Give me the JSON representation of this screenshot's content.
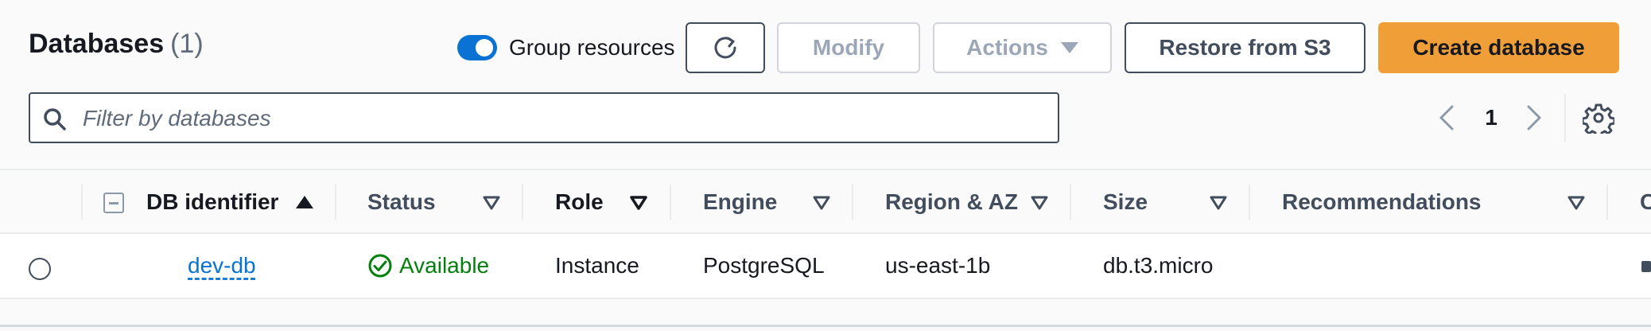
{
  "header": {
    "title": "Databases",
    "count": "(1)",
    "group_toggle_label": "Group resources",
    "group_toggle_on": true
  },
  "toolbar": {
    "refresh_icon": "refresh-icon",
    "modify_label": "Modify",
    "actions_label": "Actions",
    "restore_label": "Restore from S3",
    "create_label": "Create database"
  },
  "search": {
    "placeholder": "Filter by databases",
    "value": ""
  },
  "pagination": {
    "current_page": "1"
  },
  "table": {
    "columns": [
      {
        "label": "DB identifier",
        "sort": "ascending"
      },
      {
        "label": "Status"
      },
      {
        "label": "Role"
      },
      {
        "label": "Engine"
      },
      {
        "label": "Region & AZ"
      },
      {
        "label": "Size"
      },
      {
        "label": "Recommendations"
      }
    ],
    "rows": [
      {
        "db_identifier": "dev-db",
        "status": "Available",
        "role": "Instance",
        "engine": "PostgreSQL",
        "region_az": "us-east-1b",
        "size": "db.t3.micro",
        "recommendations": ""
      }
    ]
  },
  "colors": {
    "accent": "#0972d3",
    "primary_button": "#f09f38",
    "success": "#037f0c"
  }
}
